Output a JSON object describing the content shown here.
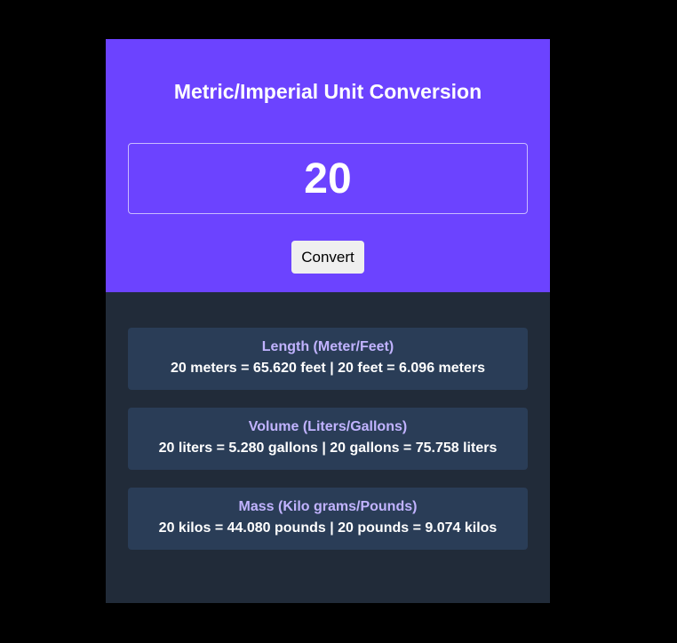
{
  "header": {
    "title": "Metric/Imperial Unit Conversion"
  },
  "input": {
    "value": "20"
  },
  "convert_button": {
    "label": "Convert"
  },
  "results": [
    {
      "heading": "Length (Meter/Feet)",
      "text": "20 meters = 65.620 feet | 20 feet = 6.096 meters"
    },
    {
      "heading": "Volume (Liters/Gallons)",
      "text": "20 liters = 5.280 gallons | 20 gallons = 75.758 liters"
    },
    {
      "heading": "Mass (Kilo grams/Pounds)",
      "text": "20 kilos = 44.080 pounds | 20 pounds = 9.074 kilos"
    }
  ],
  "colors": {
    "accent": "#6c43ff",
    "panel": "#212b39",
    "result_box": "#2a3d57",
    "result_heading": "#c1b3ff"
  }
}
